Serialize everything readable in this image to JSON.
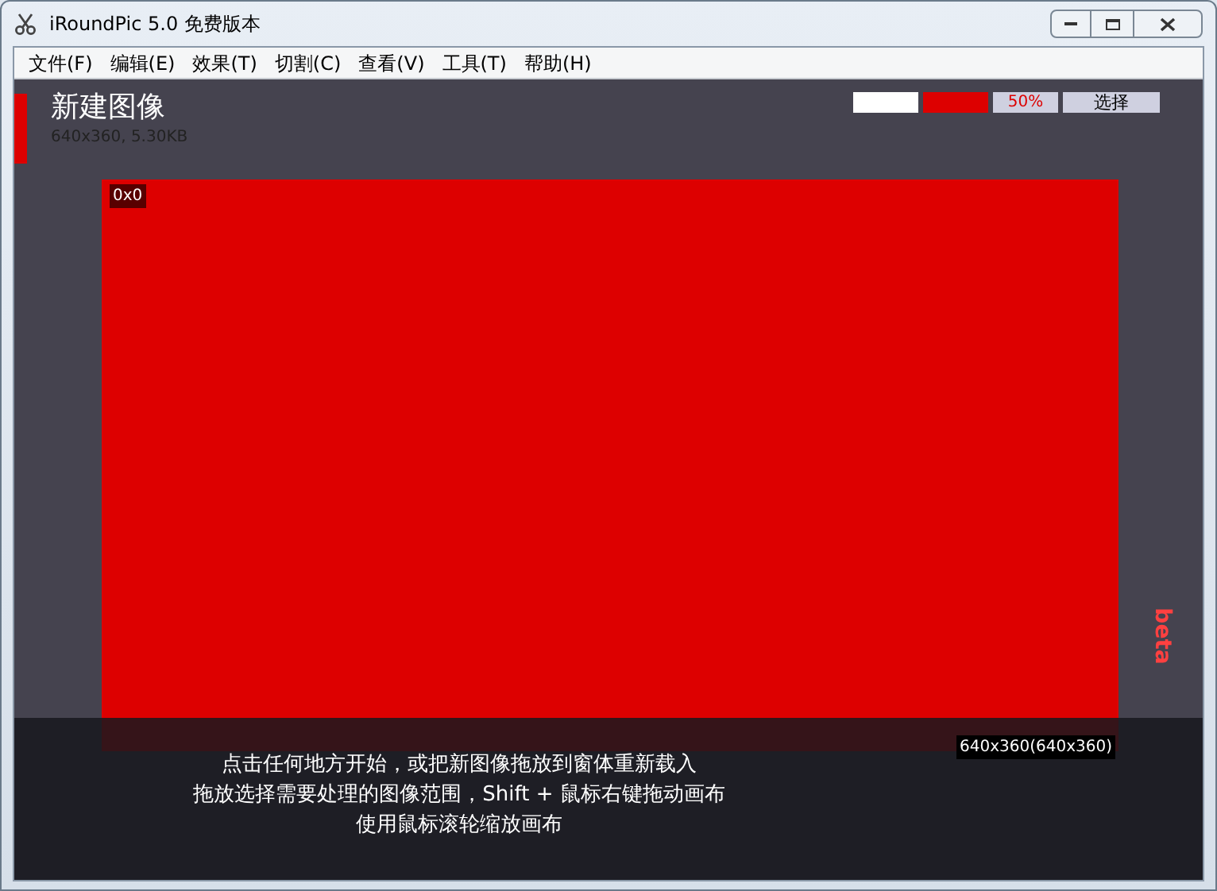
{
  "window": {
    "title": "iRoundPic 5.0 免费版本"
  },
  "menu": [
    "文件(F)",
    "编辑(E)",
    "效果(T)",
    "切割(C)",
    "查看(V)",
    "工具(T)",
    "帮助(H)"
  ],
  "toolbar": {
    "swatches": [
      {
        "color": "#ffffff"
      },
      {
        "color": "#dd0000"
      }
    ],
    "zoom": "50%",
    "select_button": "选择"
  },
  "image": {
    "title": "新建图像",
    "info": "640x360, 5.30KB"
  },
  "canvas": {
    "color": "#dd0000",
    "origin": "0x0",
    "size": "640x360(640x360)"
  },
  "hints": [
    "点击任何地方开始，或把新图像拖放到窗体重新载入",
    "拖放选择需要处理的图像范围，Shift + 鼠标右键拖动画布",
    "使用鼠标滚轮缩放画布"
  ],
  "side_label": "beta"
}
